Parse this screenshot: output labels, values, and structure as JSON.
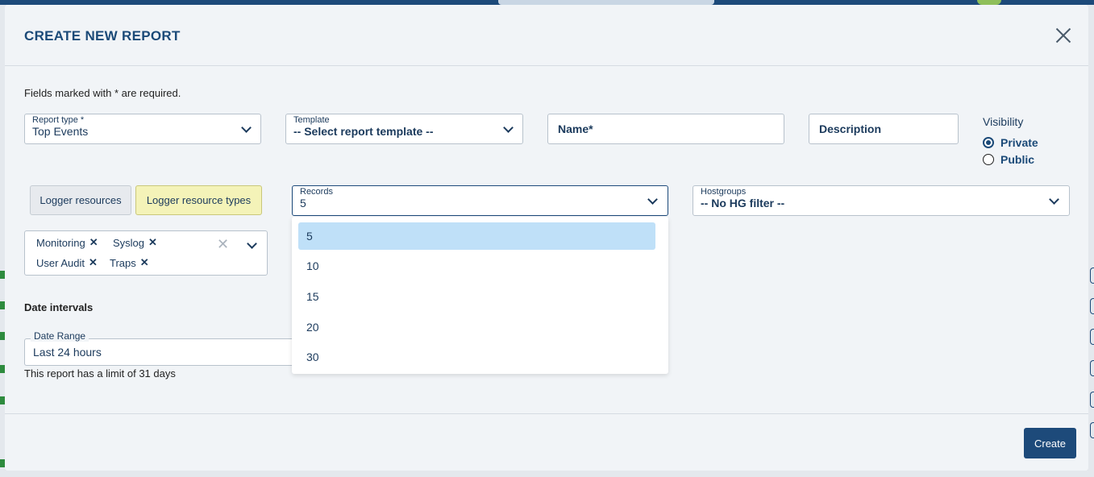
{
  "modal": {
    "title": "CREATE NEW REPORT",
    "required_note": "Fields marked with * are required."
  },
  "report_type": {
    "label": "Report type *",
    "value": "Top Events"
  },
  "template": {
    "label": "Template",
    "value": "-- Select report template --"
  },
  "name": {
    "placeholder": "Name*"
  },
  "description": {
    "placeholder": "Description"
  },
  "visibility": {
    "label": "Visibility",
    "options": [
      {
        "label": "Private",
        "checked": true
      },
      {
        "label": "Public",
        "checked": false
      }
    ]
  },
  "logger_toggle": {
    "resources": "Logger resources",
    "resource_types": "Logger resource types",
    "active": "resource_types"
  },
  "resource_types": {
    "tags": [
      "Monitoring",
      "Syslog",
      "User Audit",
      "Traps"
    ]
  },
  "records": {
    "label": "Records",
    "value": "5",
    "options": [
      "5",
      "10",
      "15",
      "20",
      "30"
    ],
    "selected": "5"
  },
  "hostgroups": {
    "label": "Hostgroups",
    "value": "-- No HG filter --"
  },
  "date_intervals": {
    "title": "Date intervals",
    "range_label": "Date Range",
    "range_value": "Last 24 hours",
    "limit_note": "This report has a limit of 31 days"
  },
  "footer": {
    "create_label": "Create"
  },
  "colors": {
    "primary": "#1d4a7a",
    "active_toggle": "#f4f3b8",
    "selected_option": "#bfe0f8"
  }
}
